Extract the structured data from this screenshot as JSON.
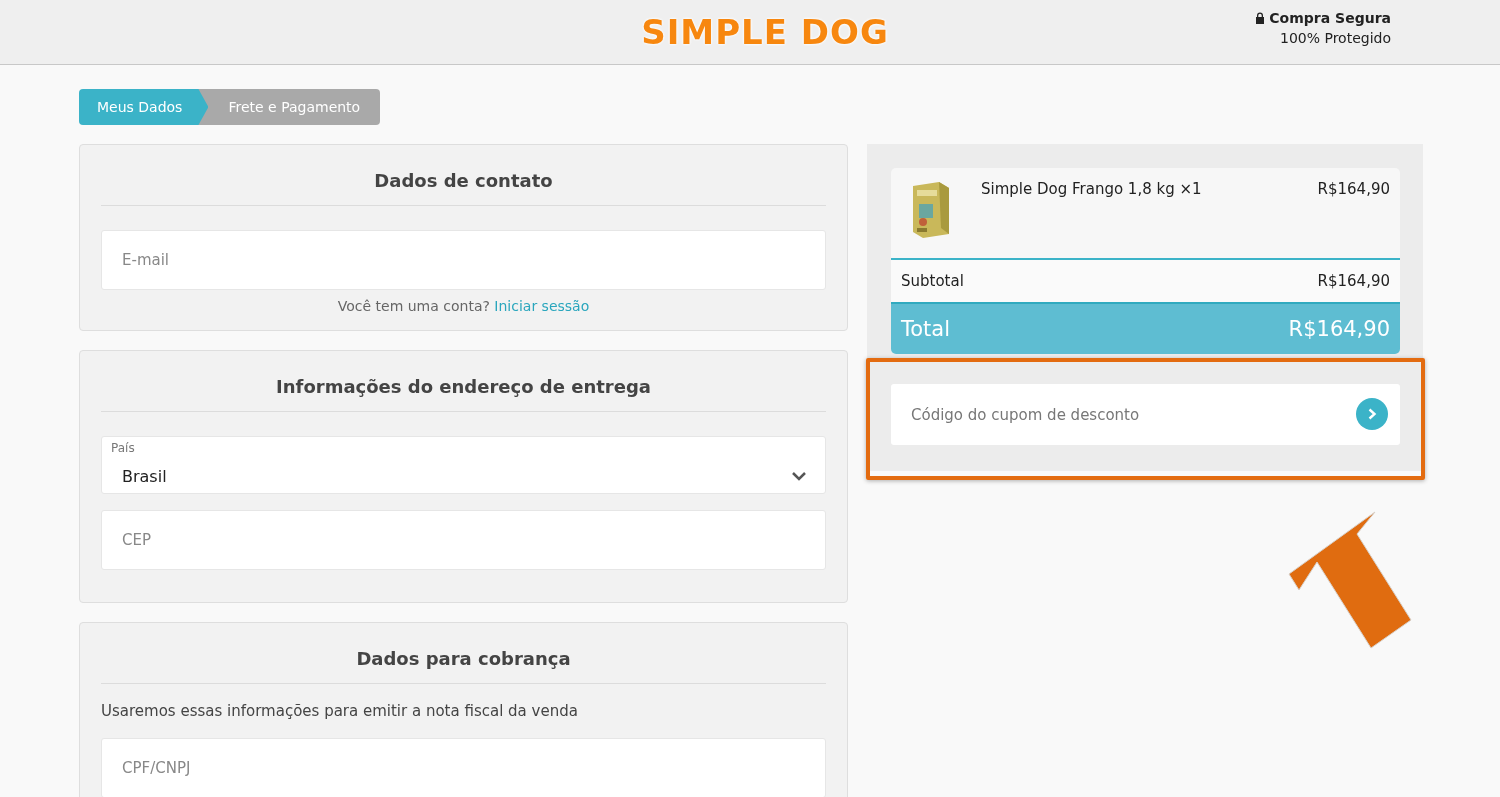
{
  "header": {
    "logo": "SIMPLE DOG",
    "secure_title": "Compra Segura",
    "secure_subtitle": "100% Protegido"
  },
  "steps": [
    {
      "label": "Meus Dados",
      "selected": true
    },
    {
      "label": "Frete e Pagamento",
      "selected": false
    }
  ],
  "contact": {
    "title": "Dados de contato",
    "email_placeholder": "E-mail",
    "account_question": "Você tem uma conta?",
    "login_link": "Iniciar sessão"
  },
  "address": {
    "title": "Informações do endereço de entrega",
    "country_label": "País",
    "country_value": "Brasil",
    "cep_placeholder": "CEP"
  },
  "billing": {
    "title": "Dados para cobrança",
    "note": "Usaremos essas informações para emitir a nota fiscal da venda",
    "document_placeholder": "CPF/CNPJ"
  },
  "summary": {
    "items": [
      {
        "kind": "picture",
        "name": "Simple Dog Frango 1,8 kg ×1",
        "price": "R$164,90"
      }
    ],
    "subtotal_label": "Subtotal",
    "subtotal_value": "R$164,90",
    "total_label": "Total",
    "total_value": "R$164,90",
    "coupon_placeholder": "Código do cupom de desconto"
  }
}
